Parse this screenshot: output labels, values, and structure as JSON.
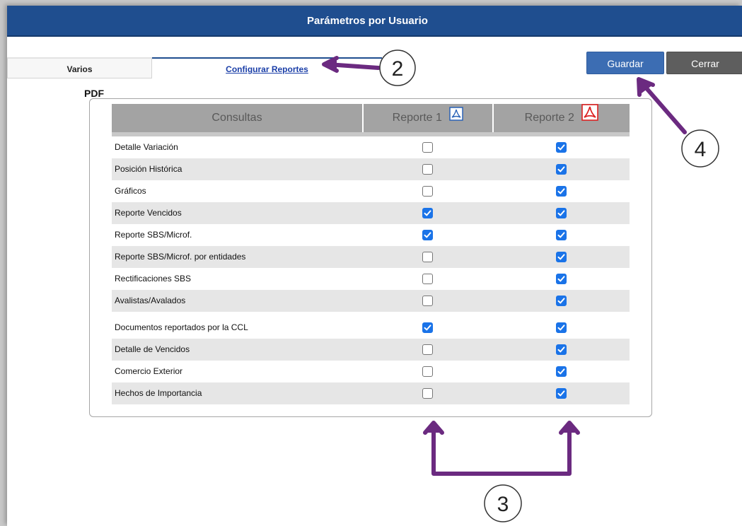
{
  "window": {
    "title": "Parámetros por Usuario"
  },
  "tabs": [
    {
      "label": "Varios"
    },
    {
      "label": "Configurar Reportes"
    }
  ],
  "section_label": "PDF",
  "buttons": {
    "save_label": "Guardar",
    "close_label": "Cerrar"
  },
  "table": {
    "headers": [
      "Consultas",
      "Reporte 1",
      "Reporte 2"
    ],
    "rows": [
      {
        "label": "Detalle Variación",
        "r1": false,
        "r2": true
      },
      {
        "label": "Posición Histórica",
        "r1": false,
        "r2": true
      },
      {
        "label": "Gráficos",
        "r1": false,
        "r2": true
      },
      {
        "label": "Reporte Vencidos",
        "r1": true,
        "r2": true
      },
      {
        "label": "Reporte SBS/Microf.",
        "r1": true,
        "r2": true
      },
      {
        "label": "Reporte SBS/Microf. por entidades",
        "r1": false,
        "r2": true
      },
      {
        "label": "Rectificaciones SBS",
        "r1": false,
        "r2": true
      },
      {
        "label": "Avalistas/Avalados",
        "r1": false,
        "r2": true
      },
      {
        "label": "Documentos reportados por la CCL",
        "r1": true,
        "r2": true
      },
      {
        "label": "Detalle de Vencidos",
        "r1": false,
        "r2": true
      },
      {
        "label": "Comercio Exterior",
        "r1": false,
        "r2": true
      },
      {
        "label": "Hechos de Importancia",
        "r1": false,
        "r2": true
      }
    ]
  },
  "annotations": [
    "2",
    "3",
    "4"
  ],
  "colors": {
    "titlebar": "#1f4e8f",
    "save_button": "#3c6db3",
    "close_button": "#5e5e5e",
    "checkbox_checked": "#1a73e8",
    "annotation_arrow": "#6b2a80"
  }
}
